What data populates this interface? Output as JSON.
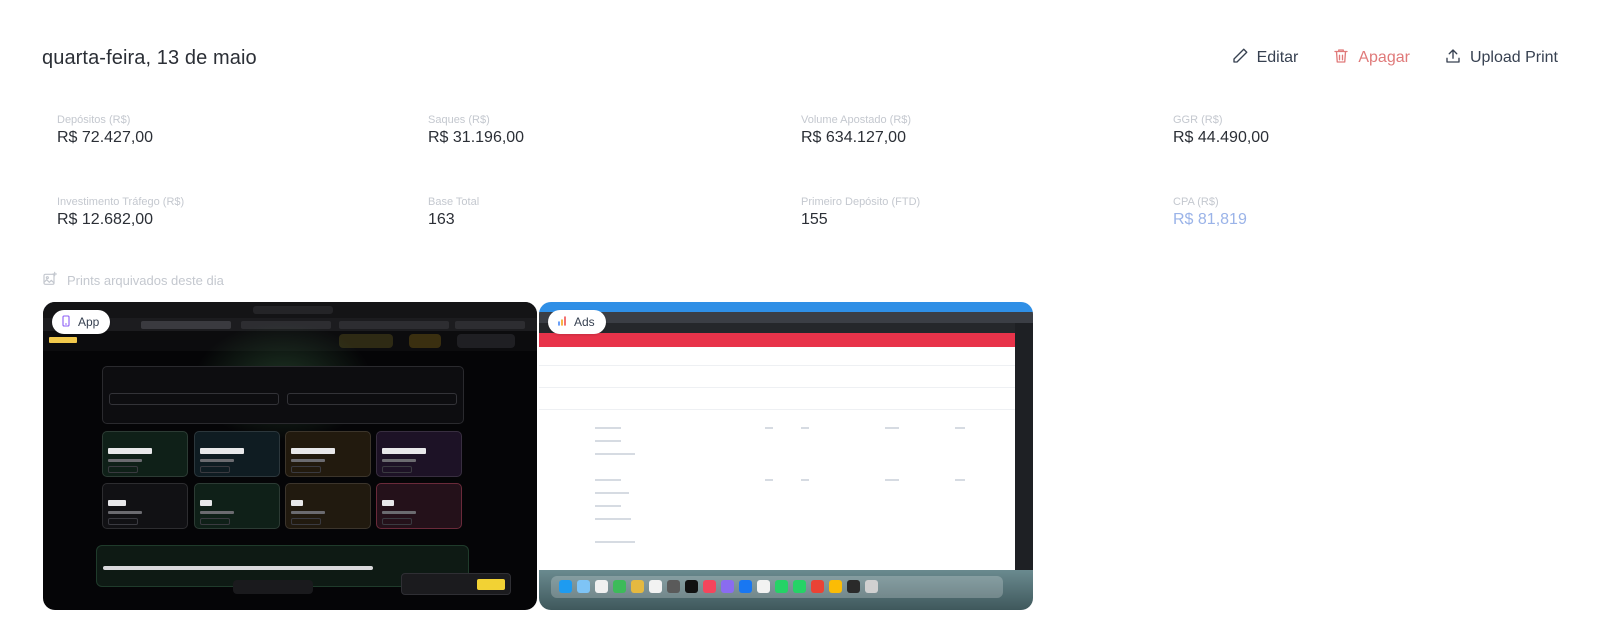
{
  "header": {
    "title": "quarta-feira, 13 de maio",
    "actions": {
      "edit_label": "Editar",
      "delete_label": "Apagar",
      "upload_label": "Upload Print"
    }
  },
  "metrics": [
    {
      "label": "Depósitos (R$)",
      "value": "R$ 72.427,00"
    },
    {
      "label": "Saques (R$)",
      "value": "R$ 31.196,00"
    },
    {
      "label": "Volume Apostado (R$)",
      "value": "R$ 634.127,00"
    },
    {
      "label": "GGR (R$)",
      "value": "R$ 44.490,00"
    },
    {
      "label": "Investimento Tráfego (R$)",
      "value": "R$ 12.682,00"
    },
    {
      "label": "Base Total",
      "value": "163"
    },
    {
      "label": "Primeiro Depósito (FTD)",
      "value": "155"
    },
    {
      "label": "CPA (R$)",
      "value": "R$ 81,819"
    }
  ],
  "prints": {
    "title": "Prints arquivados deste dia",
    "items": [
      {
        "badge": "App",
        "icon": "phone-icon"
      },
      {
        "badge": "Ads",
        "icon": "bar-chart-icon"
      }
    ]
  },
  "colors": {
    "danger": "#e07a7a",
    "accent_value": "#9ab3e8",
    "muted_label": "#c4c8cf"
  }
}
